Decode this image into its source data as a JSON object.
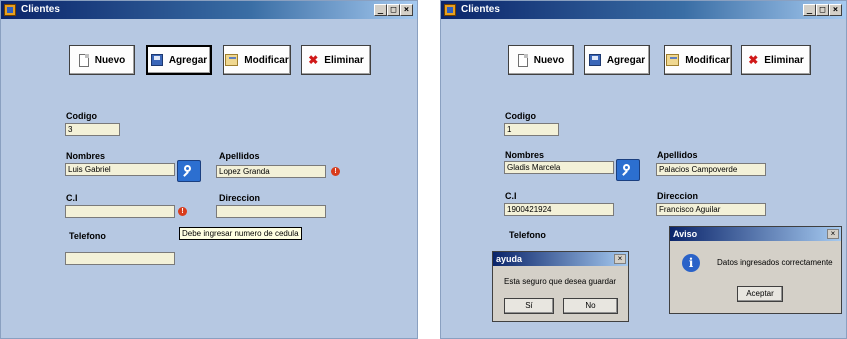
{
  "window_left": {
    "title": "Clientes",
    "controls": [
      "_",
      "□",
      "×"
    ],
    "toolbar": {
      "nuevo": "Nuevo",
      "agregar": "Agregar",
      "modificar": "Modificar",
      "eliminar": "Eliminar"
    },
    "labels": {
      "codigo": "Codigo",
      "nombres": "Nombres",
      "apellidos": "Apellidos",
      "ci": "C.I",
      "direccion": "Direccion",
      "telefono": "Telefono"
    },
    "values": {
      "codigo": "3",
      "nombres": "Luis Gabriel",
      "apellidos": "Lopez Granda",
      "ci": "",
      "direccion": "",
      "telefono": ""
    },
    "error_tooltip": "Debe ingresar numero de cedula",
    "error_mark": "!"
  },
  "window_right": {
    "title": "Clientes",
    "controls": [
      "_",
      "□",
      "×"
    ],
    "toolbar": {
      "nuevo": "Nuevo",
      "agregar": "Agregar",
      "modificar": "Modificar",
      "eliminar": "Eliminar"
    },
    "labels": {
      "codigo": "Codigo",
      "nombres": "Nombres",
      "apellidos": "Apellidos",
      "ci": "C.I",
      "direccion": "Direccion",
      "telefono": "Telefono"
    },
    "values": {
      "codigo": "1",
      "nombres": "Gladis Marcela",
      "apellidos": "Palacios Campoverde",
      "ci": "1900421924",
      "direccion": "Francisco Aguilar"
    },
    "dialog_ayuda": {
      "title": "ayuda",
      "close": "×",
      "message": "Esta seguro que desea guardar",
      "yes": "Sí",
      "no": "No"
    },
    "dialog_aviso": {
      "title": "Aviso",
      "close": "×",
      "icon": "i",
      "message": "Datos ingresados correctamente",
      "ok": "Aceptar"
    }
  },
  "colors": {
    "form_background": "#b6c8e2",
    "titlebar_start": "#0a246a",
    "field_background": "#f3f1d8",
    "error": "#d83c1c"
  }
}
